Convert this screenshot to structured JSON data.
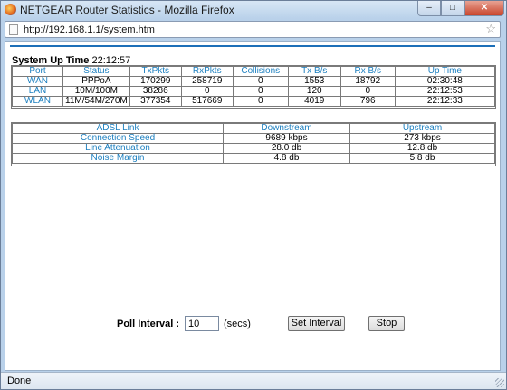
{
  "window": {
    "title": "NETGEAR Router Statistics - Mozilla Firefox",
    "minimize_glyph": "‒",
    "maximize_glyph": "□",
    "close_glyph": "✕"
  },
  "address_bar": {
    "url": "http://192.168.1.1/system.htm",
    "bookmark_icon": "star-icon"
  },
  "uptime": {
    "label": "System Up Time",
    "value": "22:12:57"
  },
  "stats_table": {
    "headers": [
      "Port",
      "Status",
      "TxPkts",
      "RxPkts",
      "Collisions",
      "Tx B/s",
      "Rx B/s",
      "Up Time"
    ],
    "rows": [
      [
        "WAN",
        "PPPoA",
        "170299",
        "258719",
        "0",
        "1553",
        "18792",
        "02:30:48"
      ],
      [
        "LAN",
        "10M/100M",
        "38286",
        "0",
        "0",
        "120",
        "0",
        "22:12:53"
      ],
      [
        "WLAN",
        "11M/54M/270M",
        "377354",
        "517669",
        "0",
        "4019",
        "796",
        "22:12:33"
      ]
    ]
  },
  "adsl_table": {
    "headers": [
      "ADSL Link",
      "Downstream",
      "Upstream"
    ],
    "rows": [
      [
        "Connection Speed",
        "9689 kbps",
        "273 kbps"
      ],
      [
        "Line Attenuation",
        "28.0 db",
        "12.8 db"
      ],
      [
        "Noise Margin",
        "4.8 db",
        "5.8 db"
      ]
    ]
  },
  "poll": {
    "label": "Poll Interval :",
    "value": "10",
    "unit": "(secs)",
    "set_button": "Set Interval",
    "stop_button": "Stop"
  },
  "status_bar": {
    "text": "Done"
  },
  "colors": {
    "accent": "#1c7fbf",
    "rule": "#1c6fb8"
  }
}
